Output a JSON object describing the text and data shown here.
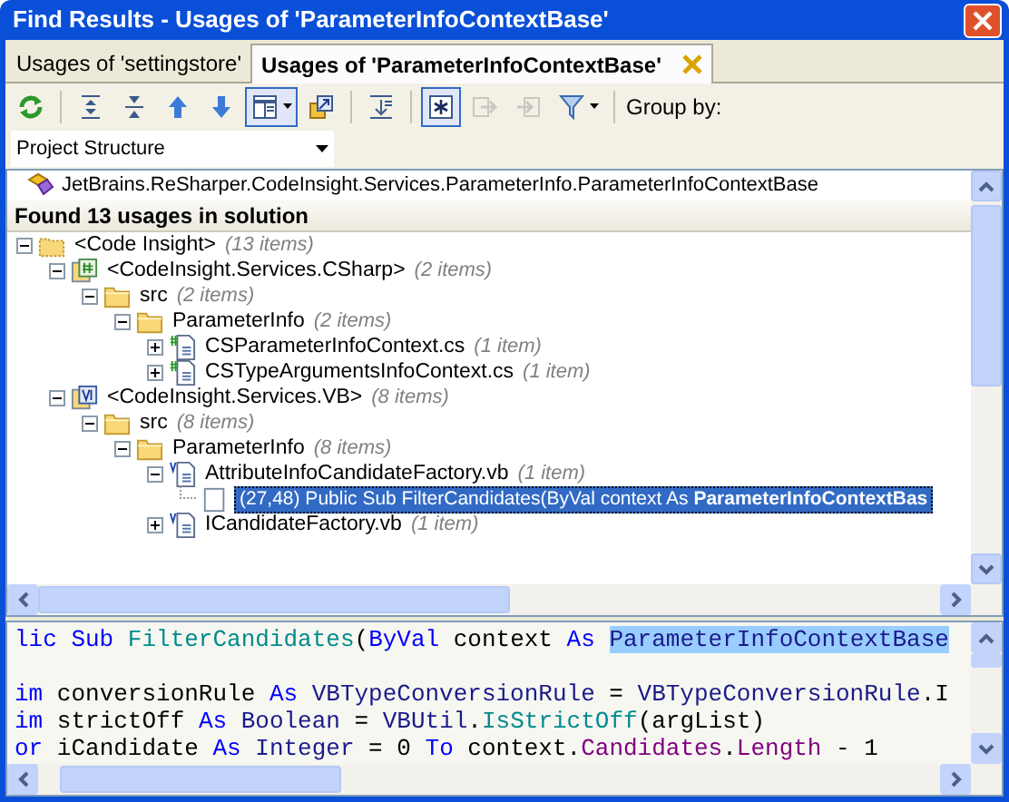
{
  "window": {
    "title": "Find Results - Usages of 'ParameterInfoContextBase'"
  },
  "tabs": [
    {
      "label": "Usages of 'settingstore'",
      "selected": false,
      "closable": false
    },
    {
      "label": "Usages of 'ParameterInfoContextBase'",
      "selected": true,
      "closable": true
    }
  ],
  "toolbar": [
    {
      "kind": "refresh",
      "pressed": false,
      "disabled": false,
      "dropdown": false
    },
    {
      "kind": "separator"
    },
    {
      "kind": "expand-all",
      "pressed": false,
      "disabled": false,
      "dropdown": false
    },
    {
      "kind": "collapse-all",
      "pressed": false,
      "disabled": false,
      "dropdown": false
    },
    {
      "kind": "up",
      "pressed": false,
      "disabled": false,
      "dropdown": false
    },
    {
      "kind": "down",
      "pressed": false,
      "disabled": false,
      "dropdown": false
    },
    {
      "kind": "preview",
      "pressed": true,
      "disabled": false,
      "dropdown": true
    },
    {
      "kind": "navigate",
      "pressed": false,
      "disabled": false,
      "dropdown": false
    },
    {
      "kind": "separator"
    },
    {
      "kind": "merge",
      "pressed": false,
      "disabled": false,
      "dropdown": false
    },
    {
      "kind": "separator"
    },
    {
      "kind": "star",
      "pressed": true,
      "disabled": false,
      "dropdown": false
    },
    {
      "kind": "export",
      "pressed": false,
      "disabled": true,
      "dropdown": false
    },
    {
      "kind": "import",
      "pressed": false,
      "disabled": true,
      "dropdown": false
    },
    {
      "kind": "filter",
      "pressed": false,
      "disabled": false,
      "dropdown": true
    },
    {
      "kind": "separator"
    }
  ],
  "group_by": {
    "label": "Group by:",
    "value": "Project Structure"
  },
  "target": "JetBrains.ReSharper.CodeInsight.Services.ParameterInfo.ParameterInfoContextBase",
  "summary": "Found 13 usages in solution",
  "tree": [
    {
      "kind": "solution-folder",
      "label": "<Code Insight>",
      "count": "(13 items)",
      "expanded": true,
      "selected": false,
      "children": [
        {
          "kind": "cs-project",
          "label": "<CodeInsight.Services.CSharp>",
          "count": "(2 items)",
          "expanded": true,
          "selected": false,
          "children": [
            {
              "kind": "folder",
              "label": "src",
              "count": "(2 items)",
              "expanded": true,
              "selected": false,
              "children": [
                {
                  "kind": "folder",
                  "label": "ParameterInfo",
                  "count": "(2 items)",
                  "expanded": true,
                  "selected": false,
                  "children": [
                    {
                      "kind": "cs-file",
                      "label": "CSParameterInfoContext.cs",
                      "count": "(1 item)",
                      "expanded": false,
                      "selected": false
                    },
                    {
                      "kind": "cs-file",
                      "label": "CSTypeArgumentsInfoContext.cs",
                      "count": "(1 item)",
                      "expanded": false,
                      "selected": false
                    }
                  ]
                }
              ]
            }
          ]
        },
        {
          "kind": "vb-project",
          "label": "<CodeInsight.Services.VB>",
          "count": "(8 items)",
          "expanded": true,
          "selected": false,
          "children": [
            {
              "kind": "folder",
              "label": "src",
              "count": "(8 items)",
              "expanded": true,
              "selected": false,
              "children": [
                {
                  "kind": "folder",
                  "label": "ParameterInfo",
                  "count": "(8 items)",
                  "expanded": true,
                  "selected": false,
                  "children": [
                    {
                      "kind": "vb-file",
                      "label": "AttributeInfoCandidateFactory.vb",
                      "count": "(1 item)",
                      "expanded": true,
                      "selected": false,
                      "children": [
                        {
                          "kind": "usage",
                          "label": "(27,48) Public Sub FilterCandidates(ByVal context As **ParameterInfoContextBas**",
                          "selected": true
                        }
                      ]
                    },
                    {
                      "kind": "vb-file",
                      "label": "ICandidateFactory.vb",
                      "count": "(1 item)",
                      "expanded": false,
                      "selected": false
                    }
                  ]
                }
              ]
            }
          ]
        }
      ]
    }
  ],
  "code_lines": [
    {
      "kind": "code",
      "tokens": [
        {
          "kind": "keyword",
          "text": "lic Sub "
        },
        {
          "kind": "method",
          "text": "FilterCandidates"
        },
        {
          "kind": "plain",
          "text": "("
        },
        {
          "kind": "keyword",
          "text": "ByVal"
        },
        {
          "kind": "plain",
          "text": " context "
        },
        {
          "kind": "keyword",
          "text": "As "
        },
        {
          "kind": "highlight",
          "text": "ParameterInfoContextBase"
        }
      ]
    },
    {
      "kind": "blank"
    },
    {
      "kind": "code",
      "tokens": [
        {
          "kind": "keyword",
          "text": "im"
        },
        {
          "kind": "plain",
          "text": " conversionRule "
        },
        {
          "kind": "keyword",
          "text": "As "
        },
        {
          "kind": "type",
          "text": "VBTypeConversionRule"
        },
        {
          "kind": "plain",
          "text": " = "
        },
        {
          "kind": "type",
          "text": "VBTypeConversionRule"
        },
        {
          "kind": "plain",
          "text": ".I"
        }
      ]
    },
    {
      "kind": "code",
      "tokens": [
        {
          "kind": "keyword",
          "text": "im"
        },
        {
          "kind": "plain",
          "text": " strictOff "
        },
        {
          "kind": "keyword",
          "text": "As "
        },
        {
          "kind": "type",
          "text": "Boolean"
        },
        {
          "kind": "plain",
          "text": " = "
        },
        {
          "kind": "type",
          "text": "VBUtil"
        },
        {
          "kind": "plain",
          "text": "."
        },
        {
          "kind": "method",
          "text": "IsStrictOff"
        },
        {
          "kind": "plain",
          "text": "(argList)"
        }
      ]
    },
    {
      "kind": "code",
      "tokens": [
        {
          "kind": "keyword",
          "text": "or"
        },
        {
          "kind": "plain",
          "text": " iCandidate "
        },
        {
          "kind": "keyword",
          "text": "As "
        },
        {
          "kind": "type",
          "text": "Integer"
        },
        {
          "kind": "plain",
          "text": " = 0 "
        },
        {
          "kind": "keyword",
          "text": "To"
        },
        {
          "kind": "plain",
          "text": " context."
        },
        {
          "kind": "property",
          "text": "Candidates"
        },
        {
          "kind": "plain",
          "text": "."
        },
        {
          "kind": "property",
          "text": "Length"
        },
        {
          "kind": "plain",
          "text": " - 1"
        }
      ]
    }
  ]
}
